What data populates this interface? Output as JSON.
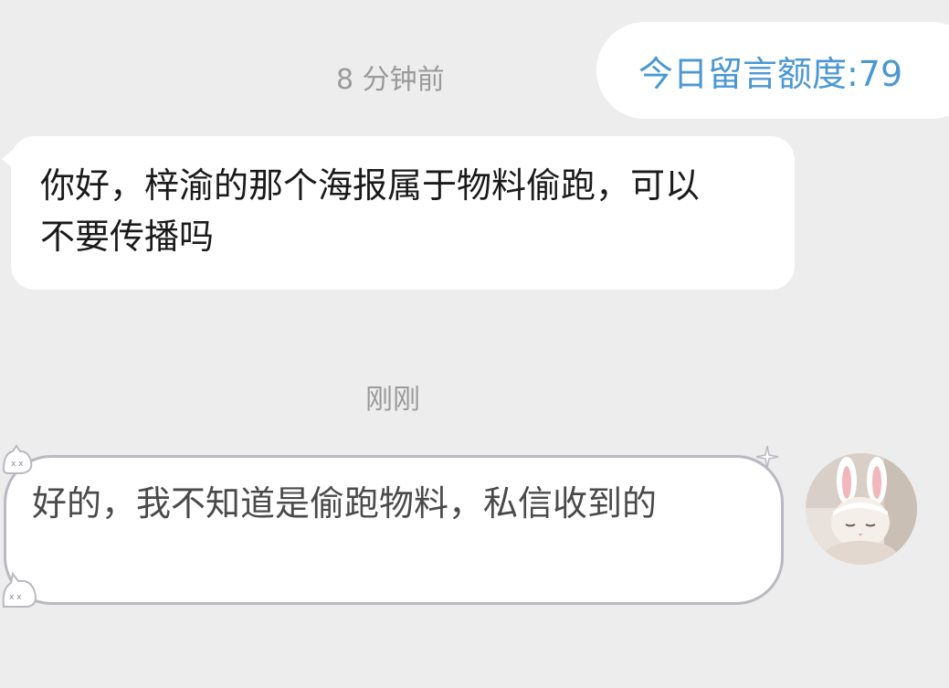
{
  "quota": {
    "text": "今日留言额度:79"
  },
  "messages": [
    {
      "time": "8 分钟前",
      "direction": "incoming",
      "text": "你好，梓渝的那个海报属于物料偷跑，可以不要传播吗"
    },
    {
      "time": "刚刚",
      "direction": "outgoing",
      "text": "好的，我不知道是偷跑物料，私信收到的"
    }
  ],
  "colors": {
    "background": "#ededed",
    "bubble": "#ffffff",
    "quota_text": "#4a98d3",
    "time_text": "#9a9a9a",
    "incoming_text": "#1a1a1a",
    "outgoing_text": "#4a4a4a",
    "outgoing_border": "#b9bac0"
  },
  "icons": {
    "avatar": "cat-with-bunny-ears-avatar",
    "bubble_decoration": "cute-cat-sticker-decoration",
    "sparkle": "sparkle-icon"
  }
}
